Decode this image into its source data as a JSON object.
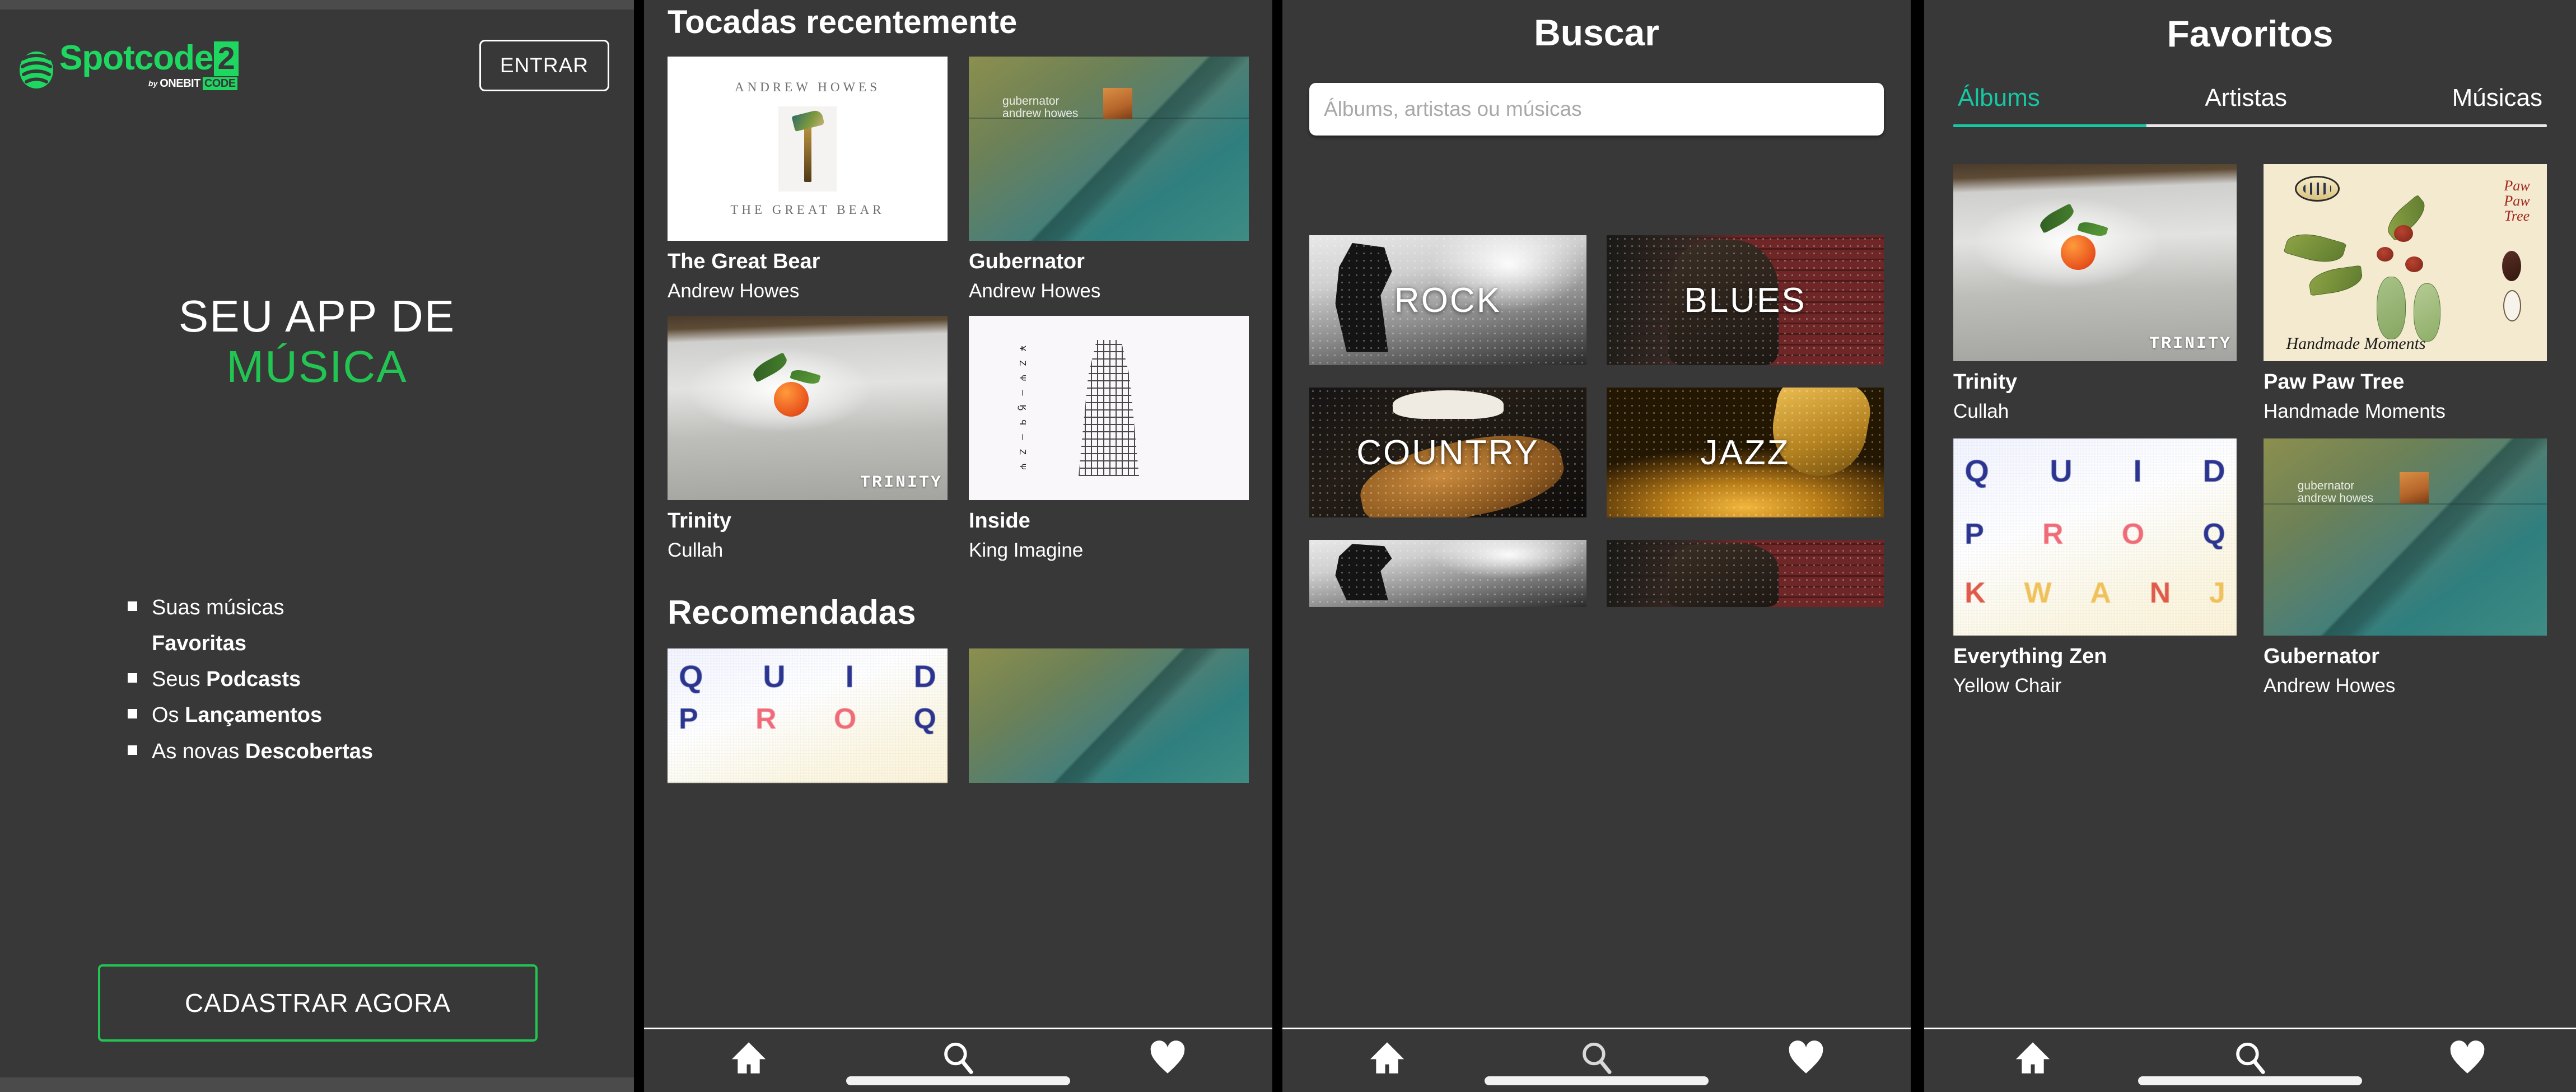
{
  "brand": {
    "name": "Spotcode",
    "version": "2",
    "byline_prefix": "by",
    "byline_onebit": "ONEBIT",
    "byline_code": "CODE",
    "accent_green": "#1ed760",
    "accent_teal": "#17c7a4"
  },
  "landing": {
    "login_button": "ENTRAR",
    "hero_line1": "SEU APP DE",
    "hero_line2": "MÚSICA",
    "features": [
      {
        "prefix": "Suas músicas",
        "bold": "",
        "sub_bold": "Favoritas"
      },
      {
        "prefix": "Seus ",
        "bold": "Podcasts",
        "sub_bold": ""
      },
      {
        "prefix": "Os ",
        "bold": "Lançamentos",
        "sub_bold": ""
      },
      {
        "prefix": "As novas ",
        "bold": "Descobertas",
        "sub_bold": ""
      }
    ],
    "cta_button": "CADASTRAR AGORA"
  },
  "home": {
    "section_recent": "Tocadas recentemente",
    "section_recommended": "Recomendadas",
    "recent": [
      {
        "title": "The Great Bear",
        "artist": "Andrew Howes",
        "art": "greatbear"
      },
      {
        "title": "Gubernator",
        "artist": "Andrew Howes",
        "art": "gubernator"
      },
      {
        "title": "Trinity",
        "artist": "Cullah",
        "art": "trinity"
      },
      {
        "title": "Inside",
        "artist": "King Imagine",
        "art": "inside"
      }
    ],
    "recommended": [
      {
        "title": "",
        "artist": "",
        "art": "zen"
      },
      {
        "title": "",
        "artist": "",
        "art": "gubernator"
      }
    ]
  },
  "search": {
    "title": "Buscar",
    "input_value": "",
    "placeholder": "Álbums, artistas ou músicas",
    "genres": [
      {
        "label": "ROCK",
        "art": "rock"
      },
      {
        "label": "BLUES",
        "art": "blues"
      },
      {
        "label": "COUNTRY",
        "art": "country"
      },
      {
        "label": "JAZZ",
        "art": "jazz"
      }
    ],
    "genres_partial": [
      {
        "label": "",
        "art": "rock"
      },
      {
        "label": "",
        "art": "blues"
      }
    ]
  },
  "favorites": {
    "title": "Favoritos",
    "tabs": [
      {
        "label": "Álbums",
        "active": true
      },
      {
        "label": "Artistas",
        "active": false
      },
      {
        "label": "Músicas",
        "active": false
      }
    ],
    "albums": [
      {
        "title": "Trinity",
        "artist": "Cullah",
        "art": "trinity"
      },
      {
        "title": "Paw Paw Tree",
        "artist": "Handmade Moments",
        "art": "pawpaw"
      },
      {
        "title": "Everything Zen",
        "artist": "Yellow Chair",
        "art": "zen"
      },
      {
        "title": "Gubernator",
        "artist": "Andrew Howes",
        "art": "gubernator"
      }
    ]
  },
  "navbar": {
    "items": [
      {
        "icon": "home-icon"
      },
      {
        "icon": "search-icon"
      },
      {
        "icon": "heart-icon"
      }
    ]
  },
  "album_art_text": {
    "greatbear_artist": "ANDREW HOWES",
    "greatbear_title": "THE GREAT BEAR",
    "gubernator_l1": "gubernator",
    "gubernator_l2": "andrew howes",
    "trinity_word": "TRINITY",
    "pawpaw_script": "Paw\nPaw\nTree",
    "pawpaw_hand": "Handmade Moments",
    "zen_r1": [
      "Q",
      "U",
      "I",
      "D"
    ],
    "zen_r2": [
      "P",
      "R",
      "O",
      "Q"
    ],
    "zen_r3": [
      "K",
      "W",
      "A",
      "N",
      ""
    ]
  }
}
